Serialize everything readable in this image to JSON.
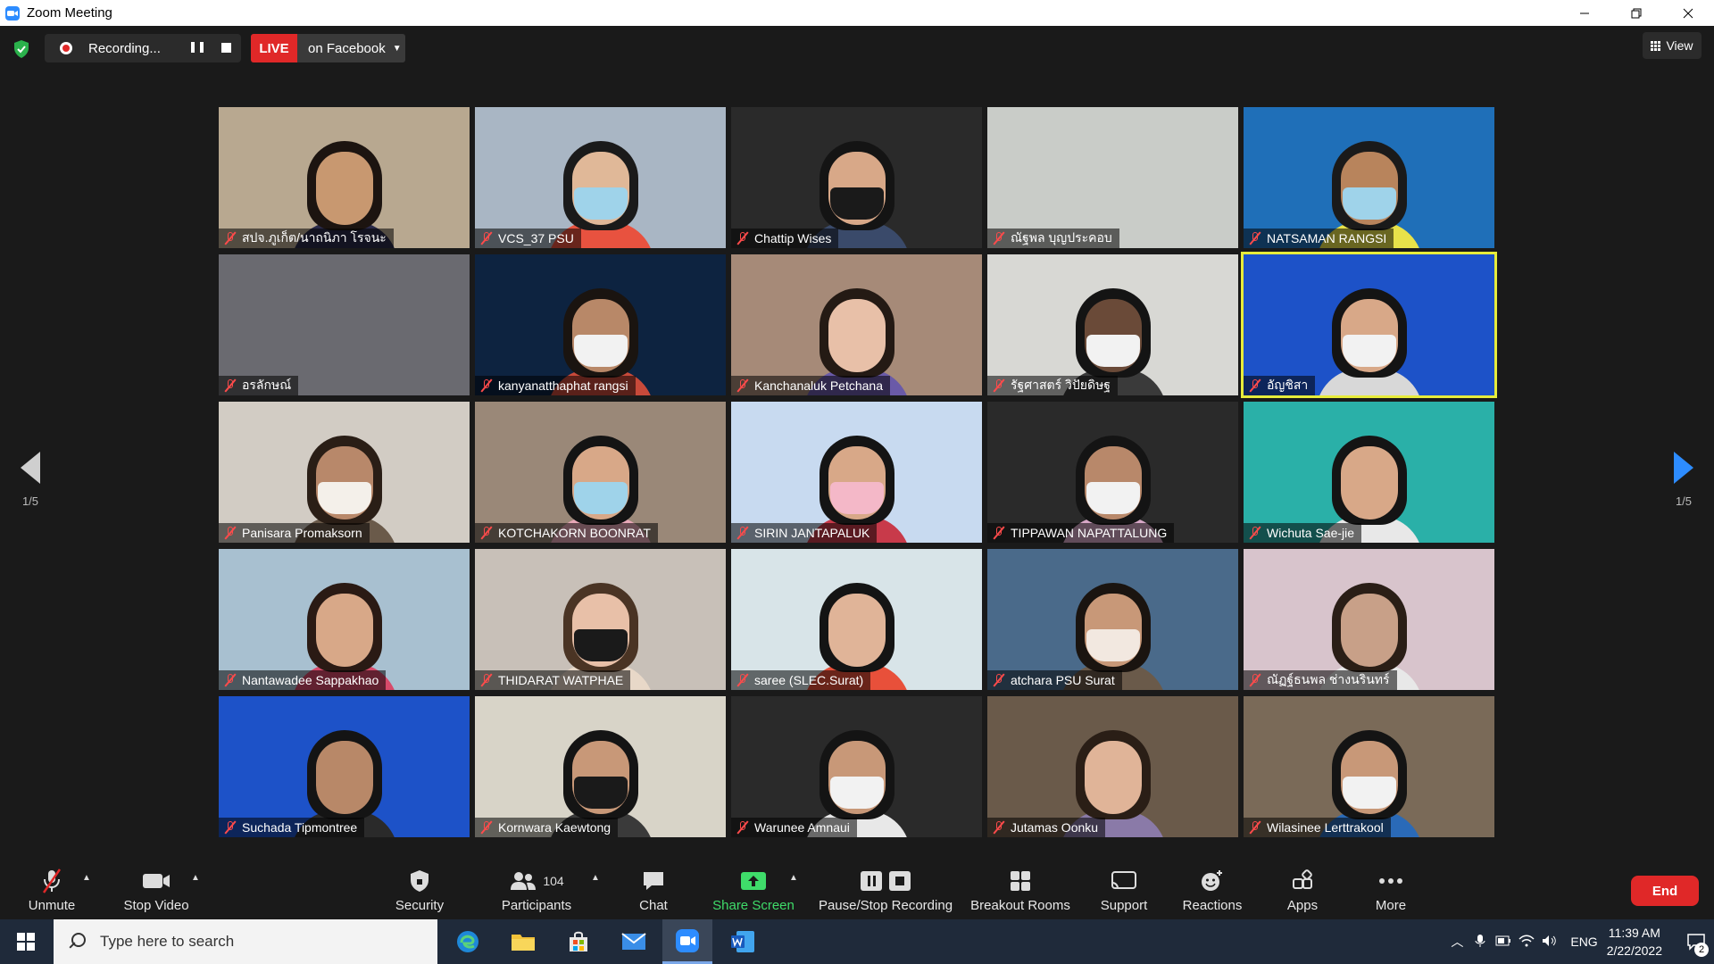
{
  "window": {
    "title": "Zoom Meeting"
  },
  "topbar": {
    "recording_label": "Recording...",
    "live_label": "LIVE",
    "live_destination": "on Facebook",
    "view_label": "View"
  },
  "pagination": {
    "left": "1/5",
    "right": "1/5"
  },
  "participants": [
    {
      "name": "สปจ.ภูเก็ต/นาถนิภา โรจนะ",
      "bg": "#b8a890",
      "skin": "#c89870",
      "hair": "#1c1410",
      "shirt": "#2b2b4a",
      "mask": ""
    },
    {
      "name": "VCS_37 PSU",
      "bg": "#a9b6c4",
      "skin": "#e0b898",
      "hair": "#1a1a1a",
      "shirt": "#e8523f",
      "mask": "#9fd3ea"
    },
    {
      "name": "Chattip Wises",
      "bg": "#2a2a2a",
      "skin": "#d8a888",
      "hair": "#141414",
      "shirt": "#3a4a6a",
      "mask": "#1a1a1a"
    },
    {
      "name": "ณัฐพล บุญประคอบ",
      "bg": "#c9ccc8",
      "skin": "",
      "hair": "",
      "shirt": "",
      "mask": ""
    },
    {
      "name": "NATSAMAN  RANGSI",
      "bg": "#1f6fb8",
      "skin": "#b8845c",
      "hair": "#1a1a1a",
      "shirt": "#e8e24a",
      "mask": "#9fd3ea"
    },
    {
      "name": "อรลักษณ์",
      "bg": "#6a6a70",
      "skin": "",
      "hair": "",
      "shirt": "",
      "mask": ""
    },
    {
      "name": "kanyanatthaphat rangsi",
      "bg": "#0d2340",
      "skin": "#b88868",
      "hair": "#1a1410",
      "shirt": "#c84a3a",
      "mask": "#f2f2f2"
    },
    {
      "name": "Kanchanaluk Petchana",
      "bg": "#a68a78",
      "skin": "#e8c0a8",
      "hair": "#241a14",
      "shirt": "#6a5aa8",
      "mask": ""
    },
    {
      "name": "รัฐศาสตร์ วิปัยดิษฐ",
      "bg": "#d8d8d4",
      "skin": "#6a4a38",
      "hair": "#141414",
      "shirt": "#3a3a3a",
      "mask": "#f2f2f2"
    },
    {
      "name": "อัญชิสา",
      "bg": "#1d52c8",
      "skin": "#d8a888",
      "hair": "#141414",
      "shirt": "#d8d8d8",
      "mask": "#f2f2f2"
    },
    {
      "name": "Panisara Promaksorn",
      "bg": "#d2ccc4",
      "skin": "#b8886a",
      "hair": "#2a1e16",
      "shirt": "#6a5a4a",
      "mask": "#f4f0ea"
    },
    {
      "name": "KOTCHAKORN BOONRAT",
      "bg": "#9a8878",
      "skin": "#d8a888",
      "hair": "#141414",
      "shirt": "#e8a8b8",
      "mask": "#9fd3ea"
    },
    {
      "name": "SIRIN JANTAPALUK",
      "bg": "#c8daf0",
      "skin": "#d8a888",
      "hair": "#141414",
      "shirt": "#c83a4a",
      "mask": "#f4b8c8"
    },
    {
      "name": "TIPPAWAN  NAPATTALUNG",
      "bg": "#2a2a2a",
      "skin": "#b8886a",
      "hair": "#141414",
      "shirt": "#d8a8c8",
      "mask": "#f2f2f2"
    },
    {
      "name": "Wichuta Sae-jie",
      "bg": "#2ab0a8",
      "skin": "#d8a888",
      "hair": "#141414",
      "shirt": "#e8e8e8",
      "mask": ""
    },
    {
      "name": "Nantawadee  Sappakhao",
      "bg": "#a8c0d0",
      "skin": "#d8a888",
      "hair": "#2a1a14",
      "shirt": "#d84a6a",
      "mask": ""
    },
    {
      "name": "THIDARAT WATPHAE",
      "bg": "#c8c0b8",
      "skin": "#e8c0a8",
      "hair": "#4a3424",
      "shirt": "#e8d8c8",
      "mask": "#1a1a1a"
    },
    {
      "name": "saree (SLEC.Surat)",
      "bg": "#d8e4e8",
      "skin": "#e0b498",
      "hair": "#141414",
      "shirt": "#e8503a",
      "mask": ""
    },
    {
      "name": "atchara  PSU Surat",
      "bg": "#4a6a8a",
      "skin": "#c89878",
      "hair": "#1a1410",
      "shirt": "#6a5a4a",
      "mask": "#f2e8e0"
    },
    {
      "name": "ณัฏฐ์ธนพล ช่างนรินทร์",
      "bg": "#d8c4cc",
      "skin": "#c8a088",
      "hair": "#2a1e16",
      "shirt": "#e8e8e8",
      "mask": ""
    },
    {
      "name": "Suchada Tipmontree",
      "bg": "#1d52c8",
      "skin": "#b88868",
      "hair": "#141414",
      "shirt": "#2a2a2a",
      "mask": ""
    },
    {
      "name": "Kornwara Kaewtong",
      "bg": "#d8d4c8",
      "skin": "#c89878",
      "hair": "#141414",
      "shirt": "#3a3a3a",
      "mask": "#1a1a1a"
    },
    {
      "name": "Warunee Amnaui",
      "bg": "#2a2a2a",
      "skin": "#c89878",
      "hair": "#141414",
      "shirt": "#e8e8e8",
      "mask": "#f2f2f2"
    },
    {
      "name": "Jutamas Oonku",
      "bg": "#6a5a4a",
      "skin": "#e0b498",
      "hair": "#2a1e16",
      "shirt": "#8a7aa8",
      "mask": ""
    },
    {
      "name": "Wilasinee Lerttrakool",
      "bg": "#7a6a58",
      "skin": "#c89878",
      "hair": "#141414",
      "shirt": "#2a6ab8",
      "mask": "#f2f2f2"
    }
  ],
  "toolbar": {
    "unmute": "Unmute",
    "stop_video": "Stop Video",
    "security": "Security",
    "participants": "Participants",
    "participants_count": "104",
    "chat": "Chat",
    "share_screen": "Share Screen",
    "pause_stop_recording": "Pause/Stop Recording",
    "breakout_rooms": "Breakout Rooms",
    "support": "Support",
    "reactions": "Reactions",
    "apps": "Apps",
    "more": "More",
    "end": "End"
  },
  "taskbar": {
    "search_placeholder": "Type here to search",
    "language": "ENG",
    "time": "11:39 AM",
    "date": "2/22/2022",
    "notification_count": "2"
  },
  "colors": {
    "accent_blue": "#2d8cff",
    "live_red": "#e02828",
    "share_green": "#3fdc6a",
    "active_speaker": "#e7ec3a"
  }
}
